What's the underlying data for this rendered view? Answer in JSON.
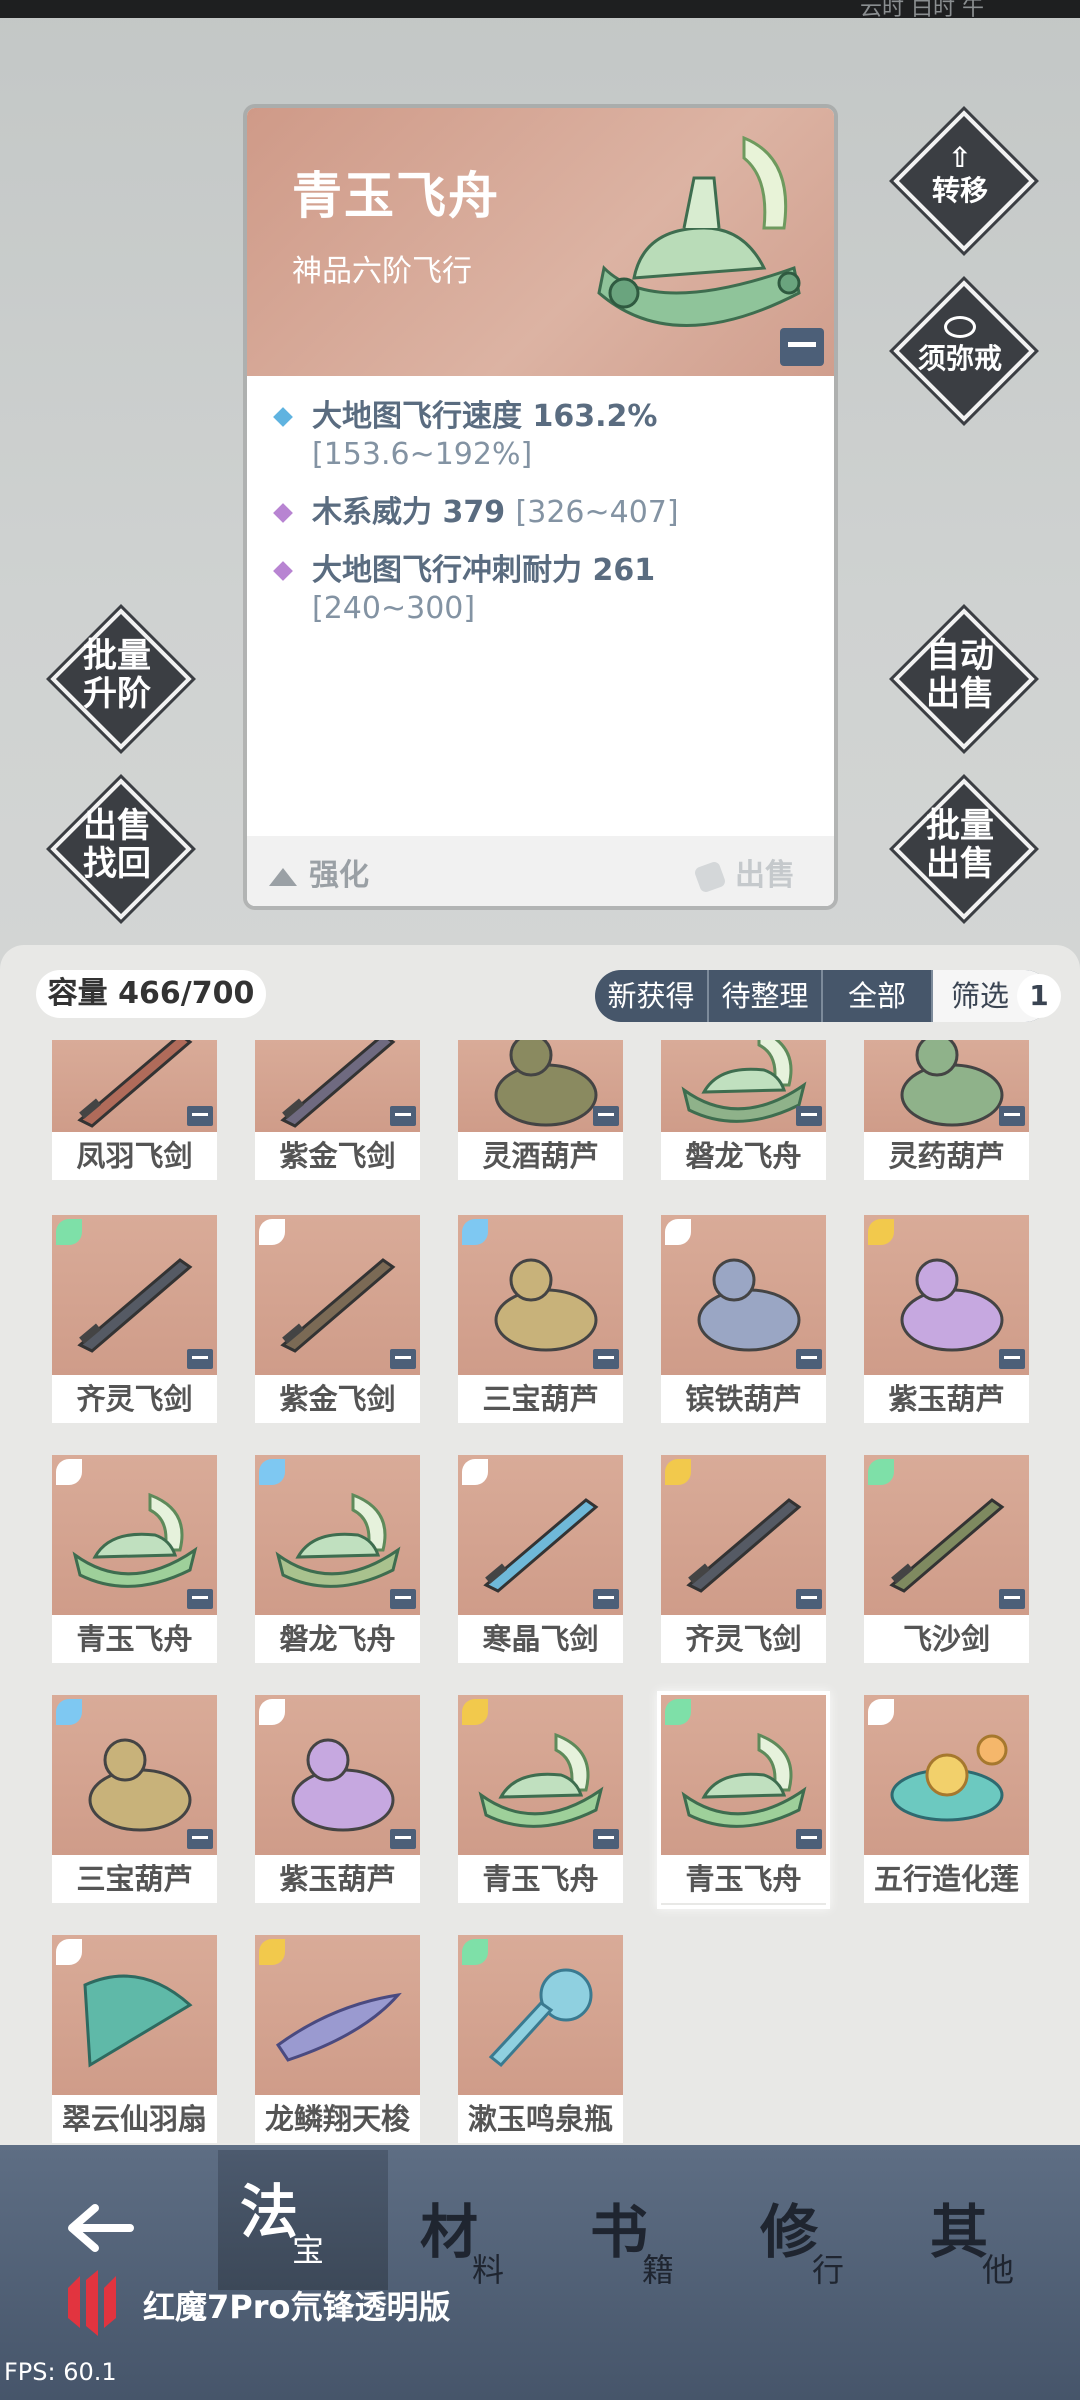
{
  "topbar": {
    "right_text": "云时  白时  午"
  },
  "detail": {
    "title": "青玉飞舟",
    "subtitle": "神品六阶飞行",
    "stats": [
      {
        "text": "大地图飞行速度 163.2%",
        "range": "[153.6~192%]",
        "color": "#5fb3e0"
      },
      {
        "text": "木系威力 379",
        "range": "[326~407]",
        "color": "#b884d2"
      },
      {
        "text": "大地图飞行冲刺耐力 261",
        "range": "[240~300]",
        "color": "#b884d2"
      }
    ],
    "enhance_label": "强化",
    "sell_label": "出售"
  },
  "side_buttons": {
    "transfer": "转移",
    "ring": "须弥戒",
    "batch_upgrade": "批量升阶",
    "auto_sell": "自动出售",
    "sell_recover": "出售找回",
    "batch_sell": "批量出售"
  },
  "inventory": {
    "capacity": "容量 466/700",
    "filters": [
      "新获得",
      "待整理",
      "全部",
      "筛选"
    ],
    "filter_badge": "1",
    "items": [
      {
        "name": "凤羽飞剑",
        "kind": "sword",
        "tint": "#b06b5a"
      },
      {
        "name": "紫金飞剑",
        "kind": "sword",
        "tint": "#6f6a80"
      },
      {
        "name": "灵酒葫芦",
        "kind": "gourd",
        "tint": "#8a8a60"
      },
      {
        "name": "磐龙飞舟",
        "kind": "boat",
        "tint": "#8fb28a"
      },
      {
        "name": "灵药葫芦",
        "kind": "gourd",
        "tint": "#8fb28a"
      },
      {
        "name": "齐灵飞剑",
        "kind": "sword",
        "tint": "#555a64"
      },
      {
        "name": "紫金飞剑",
        "kind": "sword",
        "tint": "#7b6a55"
      },
      {
        "name": "三宝葫芦",
        "kind": "gourd",
        "tint": "#c8b27a"
      },
      {
        "name": "镔铁葫芦",
        "kind": "gourd",
        "tint": "#9aa6c4"
      },
      {
        "name": "紫玉葫芦",
        "kind": "gourd",
        "tint": "#c6a8e0"
      },
      {
        "name": "青玉飞舟",
        "kind": "boat",
        "tint": "#9ed09a"
      },
      {
        "name": "磐龙飞舟",
        "kind": "boat",
        "tint": "#a9c28e"
      },
      {
        "name": "寒晶飞剑",
        "kind": "sword",
        "tint": "#6fb8d8"
      },
      {
        "name": "齐灵飞剑",
        "kind": "sword",
        "tint": "#555a64"
      },
      {
        "name": "飞沙剑",
        "kind": "sword",
        "tint": "#7f8a60"
      },
      {
        "name": "三宝葫芦",
        "kind": "gourd",
        "tint": "#c8b27a"
      },
      {
        "name": "紫玉葫芦",
        "kind": "gourd",
        "tint": "#c6a8e0"
      },
      {
        "name": "青玉飞舟",
        "kind": "boat",
        "tint": "#9ed09a"
      },
      {
        "name": "青玉飞舟",
        "kind": "boat",
        "tint": "#9ed09a"
      },
      {
        "name": "五行造化莲",
        "kind": "lotus",
        "tint": "#6cc9c0"
      },
      {
        "name": "翠云仙羽扇",
        "kind": "fan",
        "tint": "#5fb9a8"
      },
      {
        "name": "龙鳞翔天梭",
        "kind": "shuttle",
        "tint": "#9a9ad0"
      },
      {
        "name": "漱玉鸣泉瓶",
        "kind": "bottle",
        "tint": "#8fd0e0"
      }
    ]
  },
  "nav": {
    "tabs": [
      {
        "big": "法",
        "small": "宝"
      },
      {
        "big": "材",
        "small": "料"
      },
      {
        "big": "书",
        "small": "籍"
      },
      {
        "big": "修",
        "small": "行"
      },
      {
        "big": "其",
        "small": "他"
      }
    ],
    "brand": "红魔7Pro氘锋透明版",
    "fps": "FPS: 60.1"
  }
}
